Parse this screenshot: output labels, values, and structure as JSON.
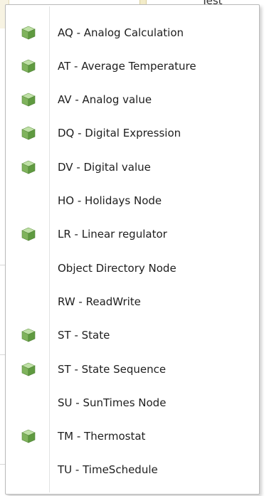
{
  "background": {
    "partial_text": "Test"
  },
  "menu": {
    "items": [
      {
        "label": "AQ - Analog Calculation",
        "icon": "cube-icon"
      },
      {
        "label": "AT - Average Temperature",
        "icon": "cube-icon"
      },
      {
        "label": "AV - Analog value",
        "icon": "cube-icon"
      },
      {
        "label": "DQ - Digital Expression",
        "icon": "cube-icon"
      },
      {
        "label": "DV - Digital value",
        "icon": "cube-icon"
      },
      {
        "label": "HO - Holidays Node",
        "icon": null
      },
      {
        "label": "LR - Linear regulator",
        "icon": "cube-icon"
      },
      {
        "label": "Object Directory Node",
        "icon": null
      },
      {
        "label": "RW - ReadWrite",
        "icon": null
      },
      {
        "label": "ST - State",
        "icon": "cube-icon"
      },
      {
        "label": "ST - State Sequence",
        "icon": "cube-icon"
      },
      {
        "label": "SU - SunTimes Node",
        "icon": null
      },
      {
        "label": "TM - Thermostat",
        "icon": "cube-icon"
      },
      {
        "label": "TU - TimeSchedule",
        "icon": null
      }
    ]
  },
  "colors": {
    "cube_top": "#bfe0a6",
    "cube_left": "#7fb35c",
    "cube_right": "#5f9a40",
    "menu_border": "#b9b9b9",
    "separator": "#e2e3e3"
  }
}
